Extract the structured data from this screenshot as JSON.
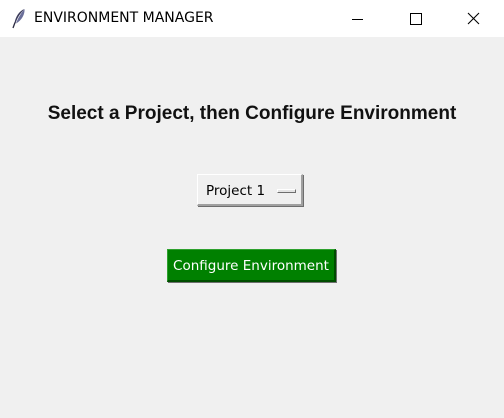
{
  "window": {
    "title": "ENVIRONMENT MANAGER",
    "icon": "feather-icon",
    "controls": {
      "minimize_icon": "minimize-icon",
      "maximize_icon": "maximize-icon",
      "close_icon": "close-icon"
    }
  },
  "main": {
    "heading": "Select a Project, then Configure Environment",
    "project_select": {
      "selected": "Project 1"
    },
    "configure_button": {
      "label": "Configure Environment",
      "background": "#008000",
      "text_color": "#ffffff"
    }
  },
  "colors": {
    "window_background": "#f0f0f0",
    "titlebar_background": "#ffffff"
  }
}
